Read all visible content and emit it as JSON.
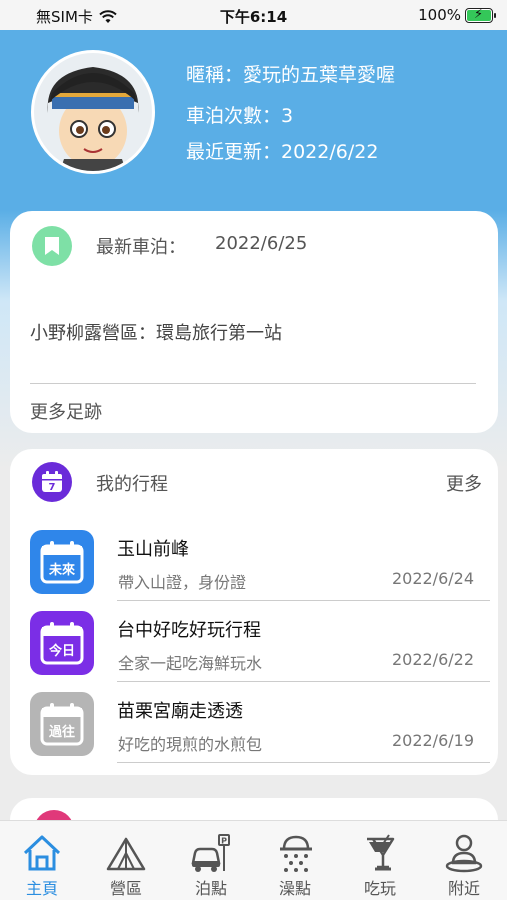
{
  "status_bar": {
    "carrier": "無SIM卡",
    "time": "下午6:14",
    "battery": "100%"
  },
  "profile": {
    "nickname_line": "暱稱：愛玩的五葉草愛喔",
    "camp_count_line": "車泊次數：3",
    "updated_line": "最近更新：2022/6/22"
  },
  "latest": {
    "title": "最新車泊：",
    "date": "2022/6/25",
    "place": "小野柳露營區：環島旅行第一站",
    "more": "更多足跡"
  },
  "schedule": {
    "title": "我的行程",
    "more": "更多",
    "icon_day": "7",
    "items": [
      {
        "badge": "未來",
        "name": "玉山前峰",
        "desc": "帶入山證，身份證",
        "date": "2022/6/24",
        "color": "#2f86ea"
      },
      {
        "badge": "今日",
        "name": "台中好吃好玩行程",
        "desc": "全家一起吃海鮮玩水",
        "date": "2022/6/22",
        "color": "#7b2ee6"
      },
      {
        "badge": "過往",
        "name": "苗栗宮廟走透透",
        "desc": "好吃的現煎的水煎包",
        "date": "2022/6/19",
        "color": "#b5b5b5"
      }
    ]
  },
  "tabs": [
    {
      "label": "主頁",
      "icon": "home-icon"
    },
    {
      "label": "營區",
      "icon": "tent-icon"
    },
    {
      "label": "泊點",
      "icon": "car-parking-icon"
    },
    {
      "label": "澡點",
      "icon": "shower-icon"
    },
    {
      "label": "吃玩",
      "icon": "drink-icon"
    },
    {
      "label": "附近",
      "icon": "person-location-icon"
    }
  ],
  "colors": {
    "header": "#5aaee6",
    "active_tab": "#2b8ee0",
    "latest_icon": "#7ee0a6",
    "schedule_icon": "#6a2bd9"
  }
}
